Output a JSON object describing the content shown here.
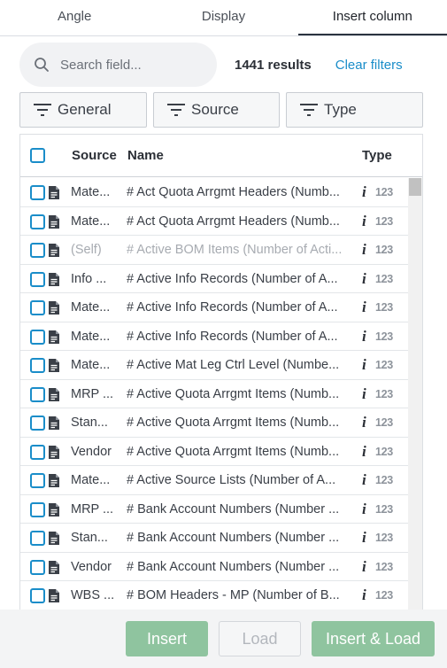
{
  "tabs": [
    {
      "label": "Angle",
      "active": false
    },
    {
      "label": "Display",
      "active": false
    },
    {
      "label": "Insert column",
      "active": true
    }
  ],
  "search": {
    "placeholder": "Search field...",
    "value": ""
  },
  "results_text": "1441 results",
  "clear_filters_label": "Clear filters",
  "filters": [
    {
      "label": "General",
      "icon": "filter-icon"
    },
    {
      "label": "Source",
      "icon": "filter-icon"
    },
    {
      "label": "Type",
      "icon": "filter-icon"
    }
  ],
  "table": {
    "headers": {
      "source": "Source",
      "name": "Name",
      "type": "Type"
    },
    "rows": [
      {
        "source": "Mate...",
        "name": "# Act Quota Arrgmt Headers (Numb...",
        "type_icon": "info-icon",
        "type_label": "123",
        "dim": false
      },
      {
        "source": "Mate...",
        "name": "# Act Quota Arrgmt Headers (Numb...",
        "type_icon": "info-icon",
        "type_label": "123",
        "dim": false
      },
      {
        "source": "(Self)",
        "name": "# Active BOM Items (Number of Acti...",
        "type_icon": "info-icon",
        "type_label": "123",
        "dim": true
      },
      {
        "source": "Info ...",
        "name": "# Active Info Records (Number of A...",
        "type_icon": "info-icon",
        "type_label": "123",
        "dim": false
      },
      {
        "source": "Mate...",
        "name": "# Active Info Records (Number of A...",
        "type_icon": "info-icon",
        "type_label": "123",
        "dim": false
      },
      {
        "source": "Mate...",
        "name": "# Active Info Records (Number of A...",
        "type_icon": "info-icon",
        "type_label": "123",
        "dim": false
      },
      {
        "source": "Mate...",
        "name": "# Active Mat Leg Ctrl Level (Numbe...",
        "type_icon": "info-icon",
        "type_label": "123",
        "dim": false
      },
      {
        "source": "MRP ...",
        "name": "# Active Quota Arrgmt Items (Numb...",
        "type_icon": "info-icon",
        "type_label": "123",
        "dim": false
      },
      {
        "source": "Stan...",
        "name": "# Active Quota Arrgmt Items (Numb...",
        "type_icon": "info-icon",
        "type_label": "123",
        "dim": false
      },
      {
        "source": "Vendor",
        "name": "# Active Quota Arrgmt Items (Numb...",
        "type_icon": "info-icon",
        "type_label": "123",
        "dim": false
      },
      {
        "source": "Mate...",
        "name": "# Active Source Lists (Number of A...",
        "type_icon": "info-icon",
        "type_label": "123",
        "dim": false
      },
      {
        "source": "MRP ...",
        "name": "# Bank Account Numbers (Number ...",
        "type_icon": "info-icon",
        "type_label": "123",
        "dim": false
      },
      {
        "source": "Stan...",
        "name": "# Bank Account Numbers (Number ...",
        "type_icon": "info-icon",
        "type_label": "123",
        "dim": false
      },
      {
        "source": "Vendor",
        "name": "# Bank Account Numbers (Number ...",
        "type_icon": "info-icon",
        "type_label": "123",
        "dim": false
      },
      {
        "source": "WBS ...",
        "name": "# BOM Headers - MP (Number of B...",
        "type_icon": "info-icon",
        "type_label": "123",
        "dim": false
      }
    ]
  },
  "buttons": {
    "insert": "Insert",
    "load": "Load",
    "insert_load": "Insert & Load"
  },
  "colors": {
    "accent": "#1a8dc9",
    "primary_button": "#8fc49f",
    "active_tab_border": "#2b3340"
  }
}
